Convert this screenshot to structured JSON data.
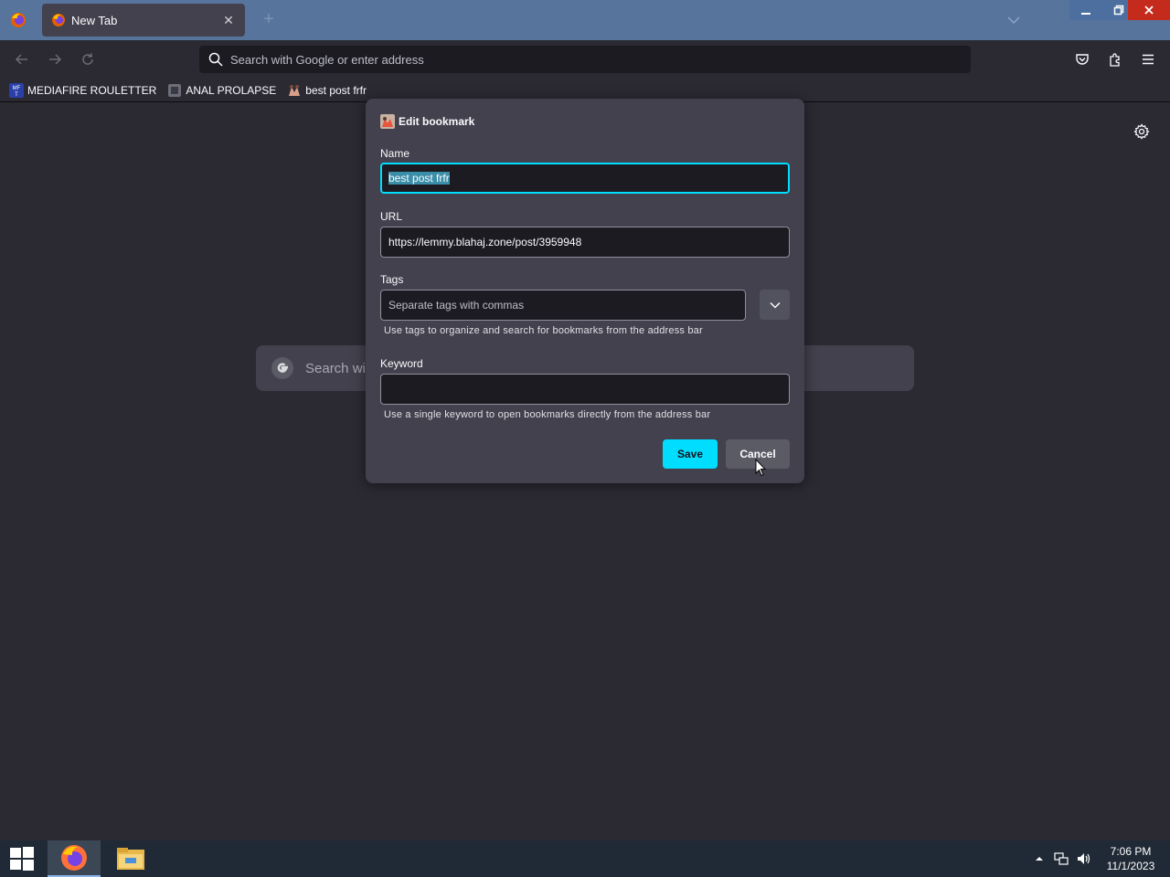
{
  "tabbar": {
    "tab_title": "New Tab",
    "new_tab_symbol": "+",
    "close_symbol": "✕"
  },
  "navbar": {
    "address_placeholder": "Search with Google or enter address"
  },
  "bookmarks": [
    {
      "label": "MEDIAFIRE ROULETTER",
      "icon": "mediafire-favicon"
    },
    {
      "label": "ANAL PROLAPSE",
      "icon": "generic-page-favicon"
    },
    {
      "label": "best post frfr",
      "icon": "lemmy-favicon"
    }
  ],
  "newtab": {
    "search_text": "Search wit"
  },
  "dialog": {
    "title": "Edit bookmark",
    "name_label": "Name",
    "name_value": "best post frfr",
    "url_label": "URL",
    "url_value": "https://lemmy.blahaj.zone/post/3959948",
    "tags_label": "Tags",
    "tags_placeholder": "Separate tags with commas",
    "tags_hint": "Use tags to organize and search for bookmarks from the address bar",
    "keyword_label": "Keyword",
    "keyword_value": "",
    "keyword_hint": "Use a single keyword to open bookmarks directly from the address bar",
    "save_label": "Save",
    "cancel_label": "Cancel"
  },
  "taskbar": {
    "time": "7:06 PM",
    "date": "11/1/2023"
  },
  "colors": {
    "accent": "#00ddff",
    "titlebar": "#56749c",
    "dialog_bg": "#42414d",
    "page_bg": "#2b2a33"
  }
}
